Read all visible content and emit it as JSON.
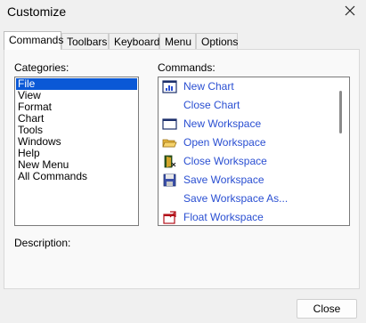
{
  "window": {
    "title": "Customize"
  },
  "tabs": [
    {
      "label": "Commands",
      "active": true
    },
    {
      "label": "Toolbars",
      "active": false
    },
    {
      "label": "Keyboard",
      "active": false
    },
    {
      "label": "Menu",
      "active": false
    },
    {
      "label": "Options",
      "active": false
    }
  ],
  "categories": {
    "label": "Categories:",
    "items": [
      "File",
      "View",
      "Format",
      "Chart",
      "Tools",
      "Windows",
      "Help",
      "New Menu",
      "All Commands"
    ],
    "selected": "File"
  },
  "commands": {
    "label": "Commands:",
    "items": [
      {
        "label": "New Chart",
        "icon": "chart-icon"
      },
      {
        "label": "Close Chart",
        "icon": ""
      },
      {
        "label": "New Workspace",
        "icon": "window-icon"
      },
      {
        "label": "Open Workspace",
        "icon": "folder-open-icon"
      },
      {
        "label": "Close Workspace",
        "icon": "close-door-icon"
      },
      {
        "label": "Save Workspace",
        "icon": "floppy-disk-icon"
      },
      {
        "label": "Save Workspace As...",
        "icon": ""
      },
      {
        "label": "Float Workspace",
        "icon": "float-window-icon"
      }
    ]
  },
  "description": {
    "label": "Description:"
  },
  "footer": {
    "close_label": "Close"
  },
  "colors": {
    "selection": "#0a58d6",
    "command_text": "#2a4fd2"
  }
}
